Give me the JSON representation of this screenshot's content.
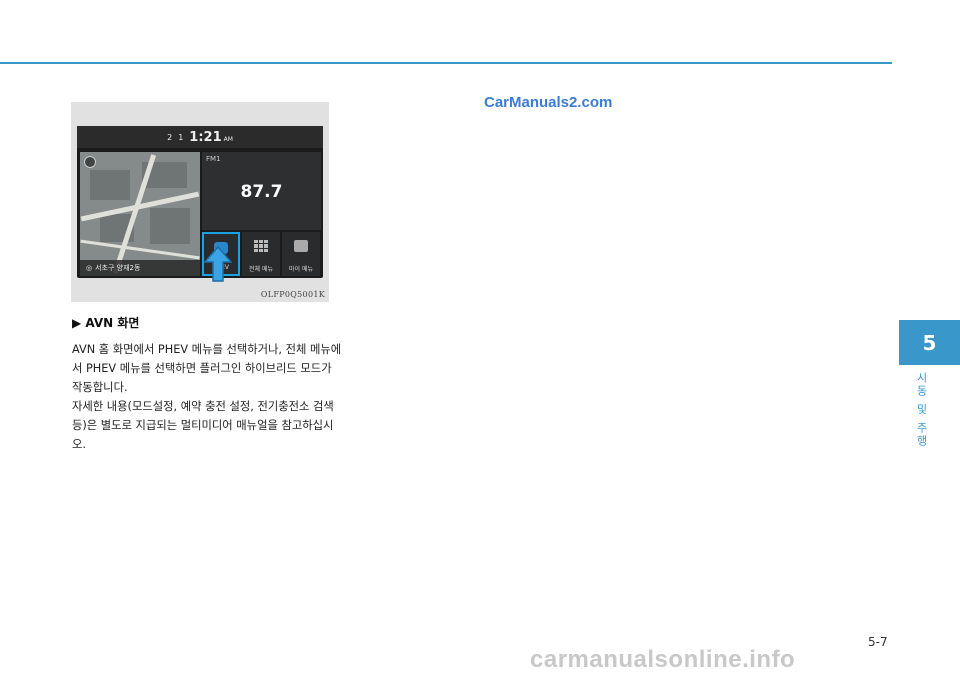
{
  "figure": {
    "status": {
      "signal_a": "2",
      "signal_b": "1",
      "time": "1:21",
      "ampm": "AM"
    },
    "map_location": "서초구 양재2동",
    "radio": {
      "band": "FM1",
      "frequency": "87.7"
    },
    "tiles": [
      {
        "label": "PHEV"
      },
      {
        "label": "전체 메뉴"
      },
      {
        "label": "마이 메뉴"
      }
    ],
    "code": "OLFP0Q5001K"
  },
  "watermark": "CarManuals2.com",
  "caption": "▶ AVN 화면",
  "paragraphs": [
    "AVN 홈 화면에서 PHEV 메뉴를 선택하거나, 전체 메뉴에서 PHEV 메뉴를 선택하면 플러그인 하이브리드 모드가 작동합니다.",
    "자세한 내용(모드설정, 예약 충전 설정, 전기충전소 검색 등)은 별도로 지급되는 멀티미디어 매뉴얼을 참고하십시오."
  ],
  "chapter": {
    "number": "5",
    "title": "시동 및 주행"
  },
  "page_number": "5-7",
  "footer_site": "carmanualsonline.info",
  "colors": {
    "accent": "#3a97c9",
    "highlight": "#1aa3e0",
    "watermark": "#3a7cd6"
  }
}
